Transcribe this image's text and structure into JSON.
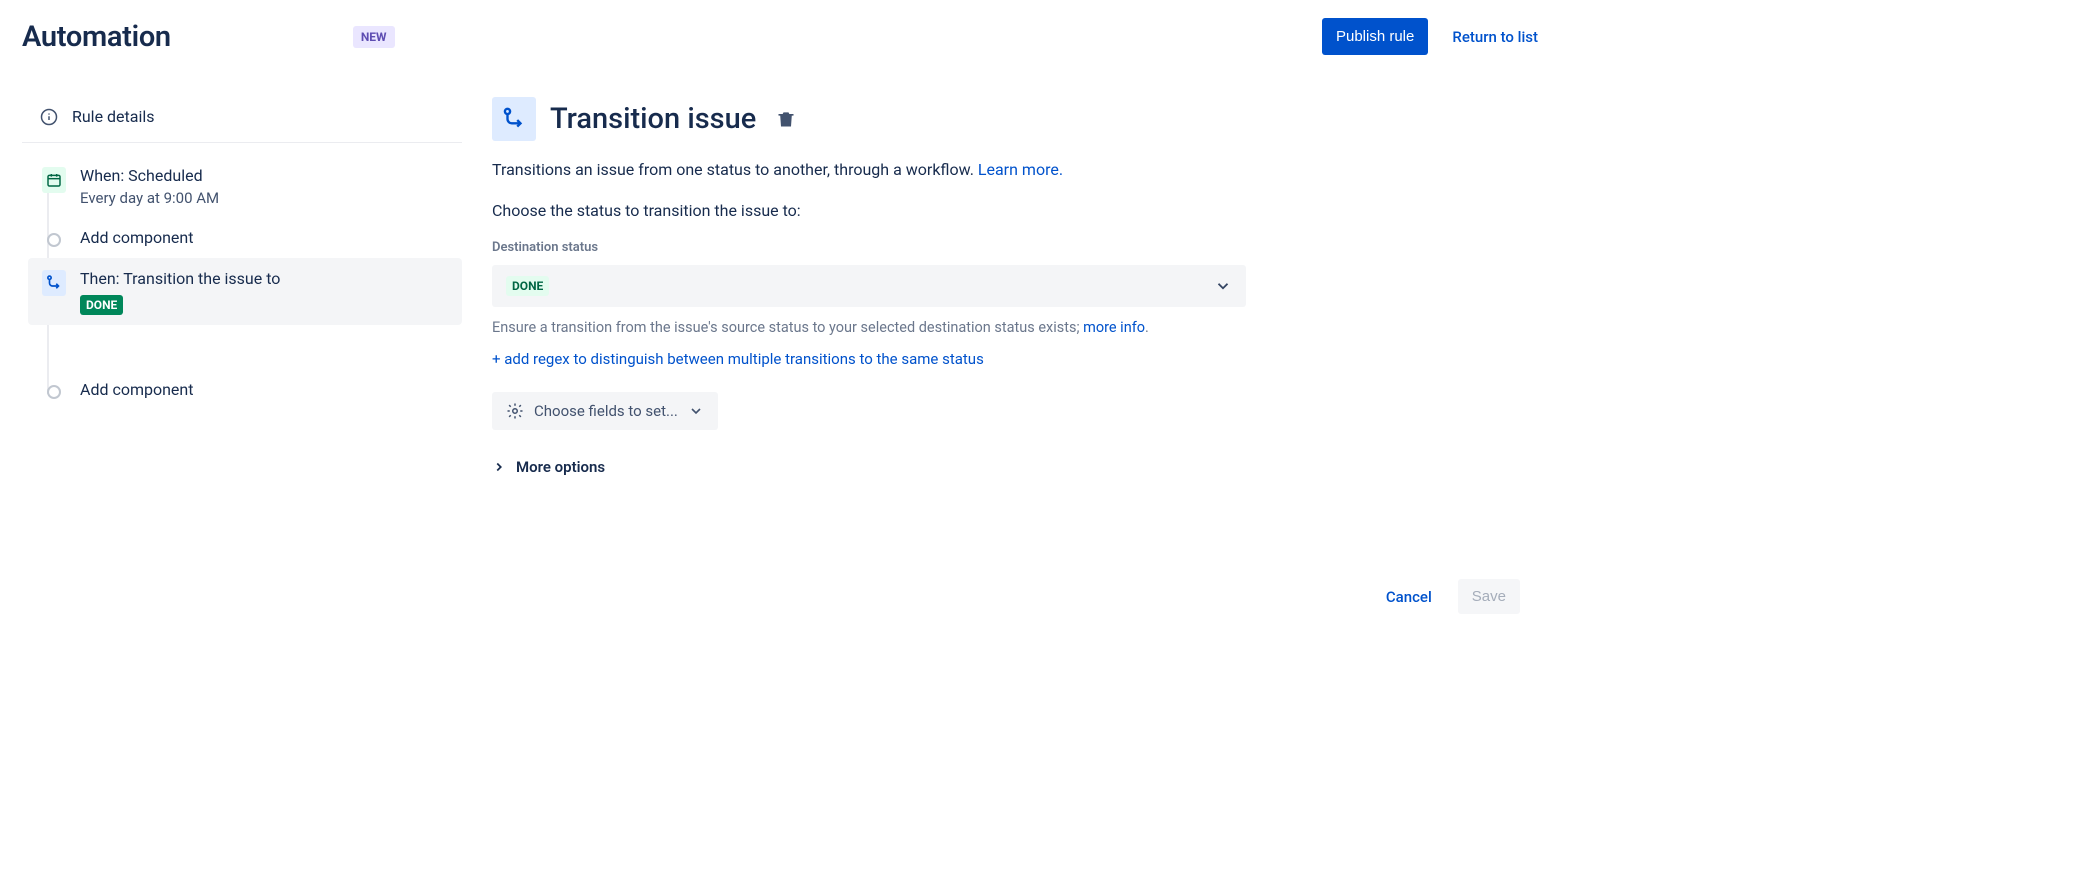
{
  "header": {
    "title": "Automation",
    "badge": "NEW",
    "publish_label": "Publish rule",
    "return_label": "Return to list"
  },
  "sidebar": {
    "rule_details": "Rule details",
    "add_component": "Add component",
    "trigger": {
      "title": "When: Scheduled",
      "subtitle": "Every day at 9:00 AM"
    },
    "action": {
      "title": "Then: Transition the issue to",
      "status_lozenge": "DONE"
    }
  },
  "main": {
    "title": "Transition issue",
    "description": "Transitions an issue from one status to another, through a workflow. ",
    "learn_more": "Learn more.",
    "choose_label": "Choose the status to transition the issue to:",
    "dest_label": "Destination status",
    "dest_value": "DONE",
    "helper_text": "Ensure a transition from the issue's source status to your selected destination status exists; ",
    "more_info": "more info",
    "add_regex": "+ add regex to distinguish between multiple transitions to the same status",
    "choose_fields": "Choose fields to set...",
    "more_options": "More options"
  },
  "footer": {
    "cancel": "Cancel",
    "save": "Save"
  }
}
